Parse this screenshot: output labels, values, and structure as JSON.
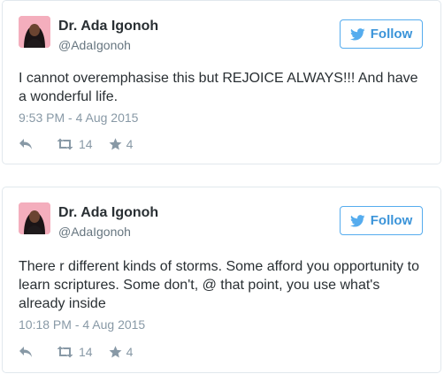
{
  "tweets": [
    {
      "author_name": "Dr. Ada Igonoh",
      "handle": "@AdaIgonoh",
      "follow_label": "Follow",
      "text": "I cannot overemphasise this but REJOICE ALWAYS!!! And have a wonderful life.",
      "timestamp": "9:53 PM - 4 Aug 2015",
      "retweets": "14",
      "likes": "4"
    },
    {
      "author_name": "Dr. Ada Igonoh",
      "handle": "@AdaIgonoh",
      "follow_label": "Follow",
      "text": "There r different kinds of storms. Some afford you opportunity to learn scriptures. Some don't, @ that point, you use what's already inside",
      "timestamp": "10:18 PM - 4 Aug 2015",
      "retweets": "14",
      "likes": "4"
    }
  ],
  "icons": {
    "follow": "bird-icon",
    "reply": "reply-icon",
    "retweet": "retweet-icon",
    "like": "star-icon"
  },
  "colors": {
    "accent": "#55acee",
    "accent_text": "#3b94d9",
    "meta_text": "#8899a6",
    "body_text": "#292f33",
    "border": "#e1e8ed"
  }
}
